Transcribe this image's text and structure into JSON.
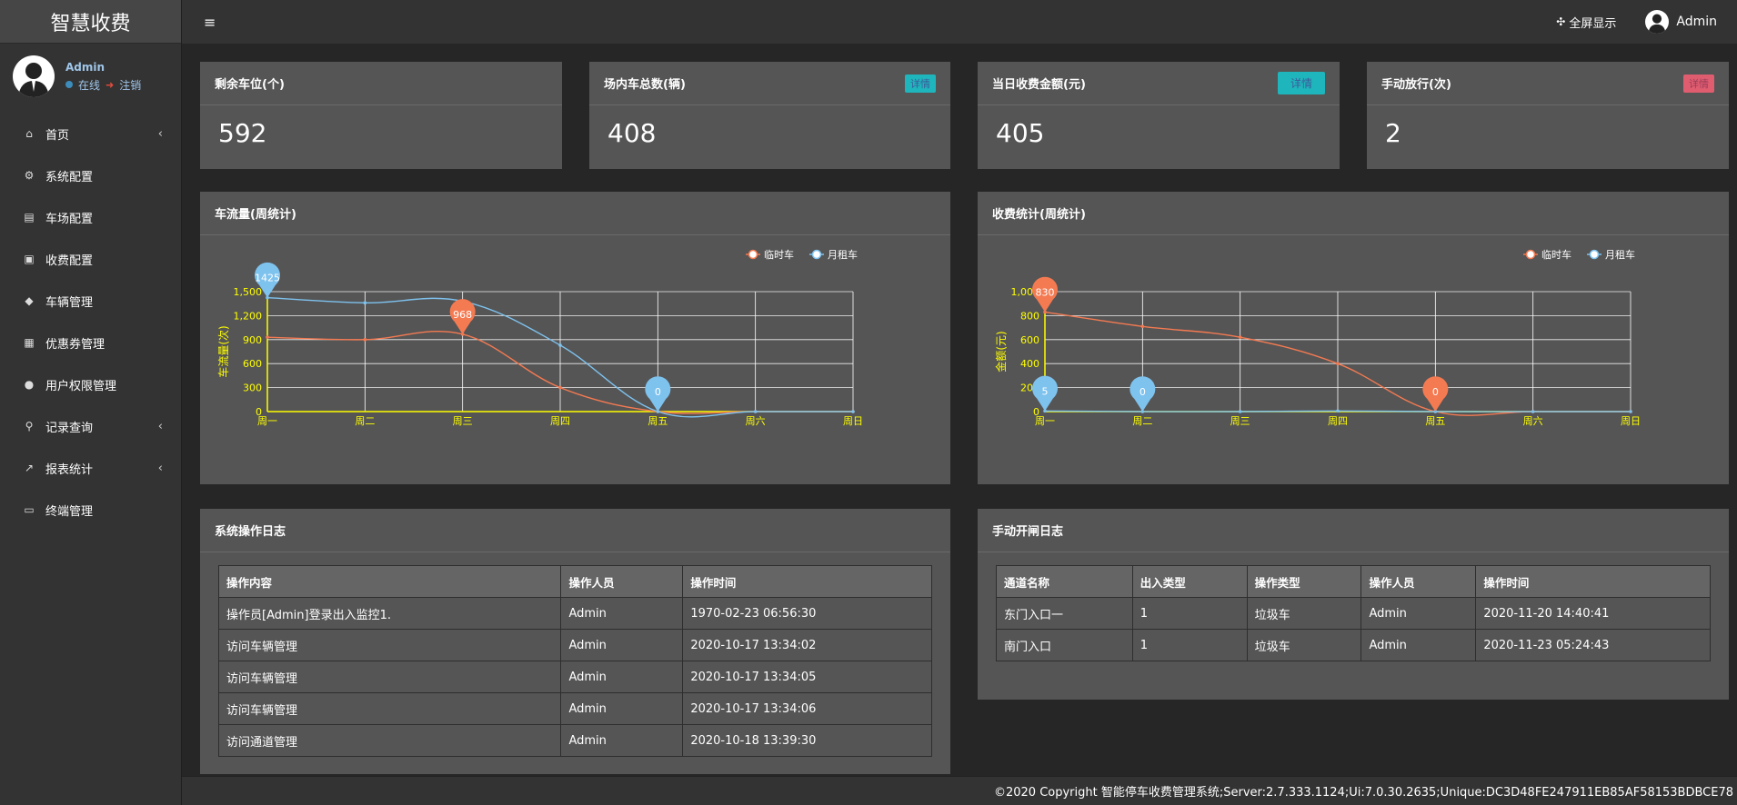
{
  "app": {
    "title": "智慧收费"
  },
  "user": {
    "name": "Admin",
    "status": "在线",
    "logout": "注销"
  },
  "topbar": {
    "fullscreen": "全屏显示",
    "username": "Admin"
  },
  "menu": [
    {
      "label": "首页",
      "icon": "home-icon",
      "glyph": "⌂",
      "arrow": true
    },
    {
      "label": "系统配置",
      "icon": "gears-icon",
      "glyph": "⚙",
      "arrow": false
    },
    {
      "label": "车场配置",
      "icon": "file-icon",
      "glyph": "▤",
      "arrow": false
    },
    {
      "label": "收费配置",
      "icon": "money-icon",
      "glyph": "▣",
      "arrow": false
    },
    {
      "label": "车辆管理",
      "icon": "car-icon",
      "glyph": "◆",
      "arrow": false
    },
    {
      "label": "优惠券管理",
      "icon": "calendar-icon",
      "glyph": "▦",
      "arrow": false
    },
    {
      "label": "用户权限管理",
      "icon": "user-circle-icon",
      "glyph": "●",
      "arrow": false
    },
    {
      "label": "记录查询",
      "icon": "search-icon",
      "glyph": "⚲",
      "arrow": true
    },
    {
      "label": "报表统计",
      "icon": "line-chart-icon",
      "glyph": "↗",
      "arrow": true
    },
    {
      "label": "终端管理",
      "icon": "monitor-icon",
      "glyph": "▭",
      "arrow": false
    }
  ],
  "stats": [
    {
      "title": "剩余车位(个)",
      "value": "592",
      "badge": ""
    },
    {
      "title": "场内车总数(辆)",
      "value": "408",
      "badge": "详情"
    },
    {
      "title": "当日收费金额(元)",
      "value": "405",
      "badge": "详情"
    },
    {
      "title": "手动放行(次)",
      "value": "2",
      "badge": "详情"
    }
  ],
  "charts": {
    "traffic_title": "车流量(周统计)",
    "revenue_title": "收费统计(周统计)"
  },
  "chart_data": [
    {
      "type": "line",
      "title": "车流量(周统计)",
      "ylabel": "车流量(次)",
      "xlabel": "",
      "categories": [
        "周一",
        "周二",
        "周三",
        "周四",
        "周五",
        "周六",
        "周日"
      ],
      "ylim": [
        0,
        1500
      ],
      "yticks": [
        "0",
        "300",
        "600",
        "900",
        "1,200",
        "1,500"
      ],
      "legend": "top-right",
      "grid": true,
      "series": [
        {
          "name": "临时车",
          "color": "#f47a52",
          "values": [
            930,
            900,
            968,
            300,
            0,
            0,
            0
          ]
        },
        {
          "name": "月租车",
          "color": "#7ec2ee",
          "values": [
            1425,
            1360,
            1380,
            830,
            0,
            0,
            0
          ]
        }
      ],
      "markers": [
        {
          "series": 1,
          "index": 0,
          "label": "1425"
        },
        {
          "series": 0,
          "index": 2,
          "label": "968"
        },
        {
          "series": 1,
          "index": 4,
          "label": "0"
        }
      ]
    },
    {
      "type": "line",
      "title": "收费统计(周统计)",
      "ylabel": "金额(元)",
      "xlabel": "",
      "categories": [
        "周一",
        "周二",
        "周三",
        "周四",
        "周五",
        "周六",
        "周日"
      ],
      "ylim": [
        0,
        1000
      ],
      "yticks": [
        "0",
        "200",
        "400",
        "600",
        "800",
        "1,000"
      ],
      "legend": "top-right",
      "grid": true,
      "series": [
        {
          "name": "临时车",
          "color": "#f47a52",
          "values": [
            830,
            710,
            620,
            400,
            0,
            0,
            0
          ]
        },
        {
          "name": "月租车",
          "color": "#7ec2ee",
          "values": [
            5,
            0,
            0,
            5,
            0,
            0,
            0
          ]
        }
      ],
      "markers": [
        {
          "series": 0,
          "index": 0,
          "label": "830"
        },
        {
          "series": 1,
          "index": 0,
          "label": "5"
        },
        {
          "series": 1,
          "index": 1,
          "label": "0"
        },
        {
          "series": 0,
          "index": 4,
          "label": "0"
        }
      ]
    }
  ],
  "op_log": {
    "title": "系统操作日志",
    "columns": [
      "操作内容",
      "操作人员",
      "操作时间"
    ],
    "rows": [
      [
        "操作员[Admin]登录出入监控1.",
        "Admin",
        "1970-02-23 06:56:30"
      ],
      [
        "访问车辆管理",
        "Admin",
        "2020-10-17 13:34:02"
      ],
      [
        "访问车辆管理",
        "Admin",
        "2020-10-17 13:34:05"
      ],
      [
        "访问车辆管理",
        "Admin",
        "2020-10-17 13:34:06"
      ],
      [
        "访问通道管理",
        "Admin",
        "2020-10-18 13:39:30"
      ]
    ]
  },
  "gate_log": {
    "title": "手动开闸日志",
    "columns": [
      "通道名称",
      "出入类型",
      "操作类型",
      "操作人员",
      "操作时间"
    ],
    "rows": [
      [
        "东门入口一",
        "1",
        "垃圾车",
        "Admin",
        "2020-11-20 14:40:41"
      ],
      [
        "南门入口",
        "1",
        "垃圾车",
        "Admin",
        "2020-11-23 05:24:43"
      ]
    ]
  },
  "footer": {
    "text": "©2020 Copyright  智能停车收费管理系统;Server:2.7.333.1124;Ui:7.0.30.2635;Unique:DC3D48FE247911EB85AF58153BDBCE78"
  }
}
